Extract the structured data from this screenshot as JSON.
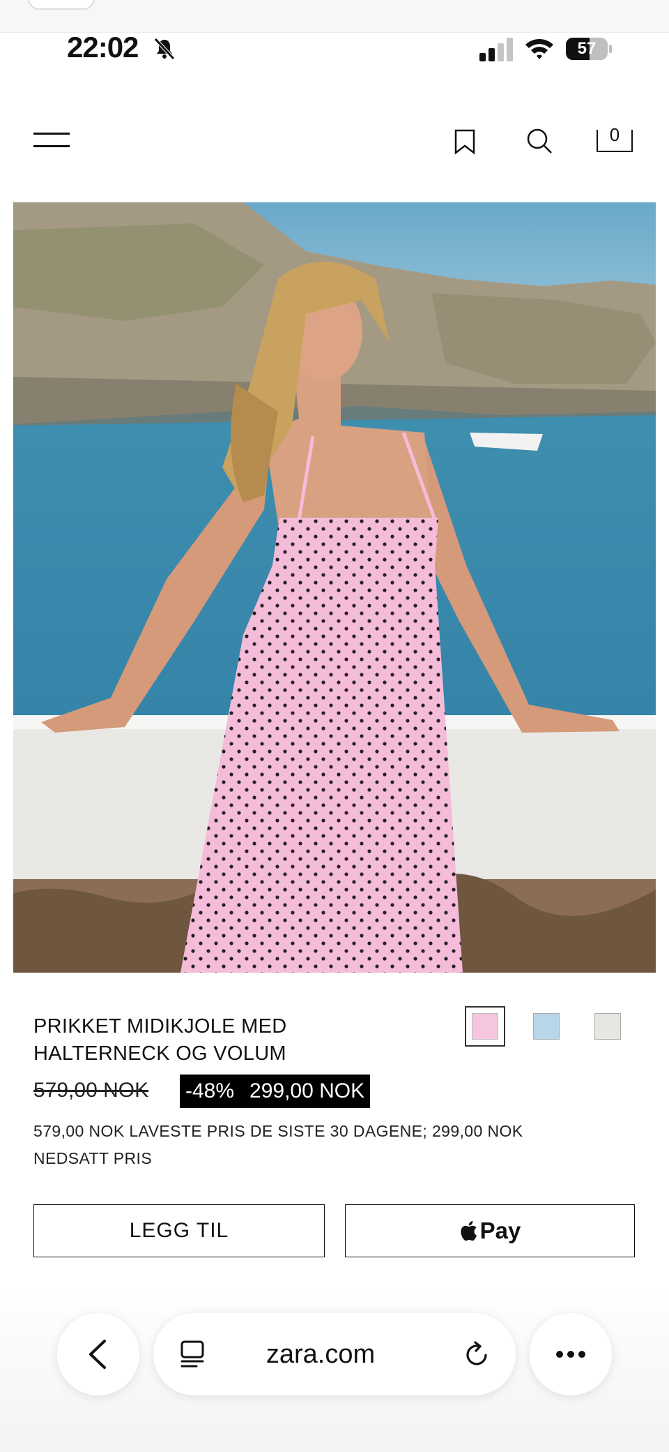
{
  "status_bar": {
    "time": "22:02",
    "battery": "57",
    "battery_level": 0.57
  },
  "header": {
    "cart_count": "0"
  },
  "hero": {
    "image_alt": "Model in pink polka-dot halterneck midi dress by the sea"
  },
  "product": {
    "title_line1": "PRIKKET MIDIKJOLE MED",
    "title_line2": "HALTERNECK OG VOLUM",
    "old_price": "579,00 NOK",
    "discount": "-48%",
    "sale_price": "299,00 NOK",
    "note_line1": "579,00 NOK LAVESTE PRIS DE SISTE 30 DAGENE; 299,00 NOK",
    "note_line2": "NEDSATT PRIS",
    "colors": [
      "#f5c6de",
      "#b9d6e8",
      "#e8e6e0"
    ]
  },
  "actions": {
    "add_label": "LEGG TIL",
    "pay_label": "Pay"
  },
  "browser": {
    "url": "zara.com"
  }
}
